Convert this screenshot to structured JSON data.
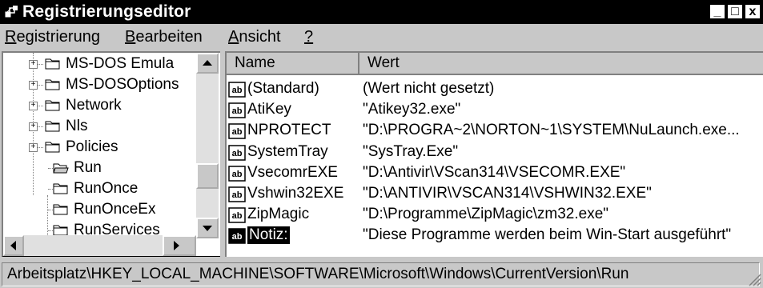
{
  "window": {
    "title": "Registrierungseditor"
  },
  "titlebar_buttons": {
    "minimize": "_",
    "maximize": "□",
    "close": "x"
  },
  "menu": [
    {
      "pre": "",
      "key": "R",
      "post": "egistrierung"
    },
    {
      "pre": "",
      "key": "B",
      "post": "earbeiten"
    },
    {
      "pre": "",
      "key": "A",
      "post": "nsicht"
    },
    {
      "pre": "",
      "key": "?",
      "post": ""
    }
  ],
  "tree": {
    "items": [
      {
        "label": "MS-DOS Emula",
        "expandable": true,
        "icon": "closed-folder-icon"
      },
      {
        "label": "MS-DOSOptions",
        "expandable": true,
        "icon": "closed-folder-icon"
      },
      {
        "label": "Network",
        "expandable": true,
        "icon": "closed-folder-icon"
      },
      {
        "label": "Nls",
        "expandable": true,
        "icon": "closed-folder-icon"
      },
      {
        "label": "Policies",
        "expandable": true,
        "icon": "closed-folder-icon"
      },
      {
        "label": "Run",
        "expandable": false,
        "icon": "open-folder-icon"
      },
      {
        "label": "RunOnce",
        "expandable": false,
        "icon": "closed-folder-icon"
      },
      {
        "label": "RunOnceEx",
        "expandable": false,
        "icon": "closed-folder-icon"
      },
      {
        "label": "RunServices",
        "expandable": false,
        "icon": "closed-folder-icon"
      }
    ]
  },
  "list": {
    "columns": {
      "name": "Name",
      "value": "Wert"
    },
    "rows": [
      {
        "name": "(Standard)",
        "value": "(Wert nicht gesetzt)",
        "selected": false
      },
      {
        "name": "AtiKey",
        "value": "\"Atikey32.exe\"",
        "selected": false
      },
      {
        "name": "NPROTECT",
        "value": "\"D:\\PROGRA~2\\NORTON~1\\SYSTEM\\NuLaunch.exe...",
        "selected": false
      },
      {
        "name": "SystemTray",
        "value": "\"SysTray.Exe\"",
        "selected": false
      },
      {
        "name": "VsecomrEXE",
        "value": "\"D:\\Antivir\\VScan314\\VSECOMR.EXE\"",
        "selected": false
      },
      {
        "name": "Vshwin32EXE",
        "value": "\"D:\\ANTIVIR\\VSCAN314\\VSHWIN32.EXE\"",
        "selected": false
      },
      {
        "name": "ZipMagic",
        "value": "\"D:\\Programme\\ZipMagic\\zm32.exe\"",
        "selected": false
      },
      {
        "name": "Notiz:",
        "value": "\"Diese Programme werden beim Win-Start ausgeführt\"",
        "selected": true
      }
    ]
  },
  "status": {
    "path": "Arbeitsplatz\\HKEY_LOCAL_MACHINE\\SOFTWARE\\Microsoft\\Windows\\CurrentVersion\\Run"
  },
  "colors": {
    "face": "#c8c8c8",
    "shadow": "#808080",
    "titlebar": "#000000",
    "selection": "#000000"
  }
}
